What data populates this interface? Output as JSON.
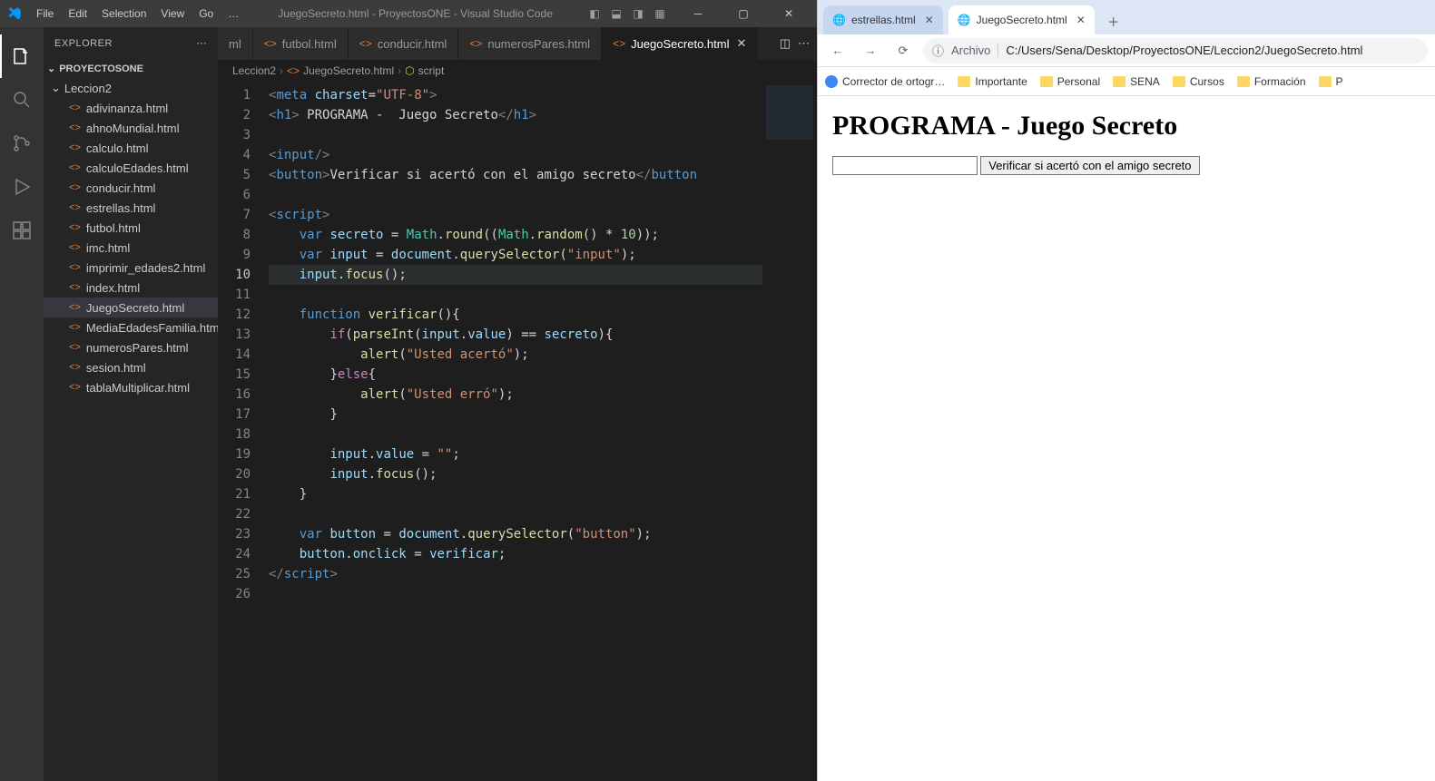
{
  "vscode": {
    "menus": [
      "File",
      "Edit",
      "Selection",
      "View",
      "Go",
      "…"
    ],
    "title": "JuegoSecreto.html - ProyectosONE - Visual Studio Code",
    "explorer": {
      "label": "EXPLORER",
      "project": "PROYECTOSONE",
      "folder": "Leccion2",
      "files": [
        "adivinanza.html",
        "ahnoMundial.html",
        "calculo.html",
        "calculoEdades.html",
        "conducir.html",
        "estrellas.html",
        "futbol.html",
        "imc.html",
        "imprimir_edades2.html",
        "index.html",
        "JuegoSecreto.html",
        "MediaEdadesFamilia.html",
        "numerosPares.html",
        "sesion.html",
        "tablaMultiplicar.html"
      ],
      "active": "JuegoSecreto.html"
    },
    "tabs": [
      {
        "label": "ml",
        "active": false,
        "partial": true
      },
      {
        "label": "futbol.html",
        "active": false
      },
      {
        "label": "conducir.html",
        "active": false
      },
      {
        "label": "numerosPares.html",
        "active": false
      },
      {
        "label": "JuegoSecreto.html",
        "active": true
      }
    ],
    "breadcrumbs": [
      "Leccion2",
      "JuegoSecreto.html",
      "script"
    ],
    "lineCount": 26,
    "activeLine": 10
  },
  "browser": {
    "tabs": [
      {
        "label": "estrellas.html",
        "active": false
      },
      {
        "label": "JuegoSecreto.html",
        "active": true
      }
    ],
    "addressLabel": "Archivo",
    "url": "C:/Users/Sena/Desktop/ProyectosONE/Leccion2/JuegoSecreto.html",
    "bookmarks": [
      "Corrector de ortogr…",
      "Importante",
      "Personal",
      "SENA",
      "Cursos",
      "Formación",
      "P"
    ],
    "pageTitle": "PROGRAMA - Juego Secreto",
    "buttonLabel": "Verificar si acertó con el amigo secreto"
  },
  "code": {
    "l1": {
      "charset": "charset",
      "utf": "\"UTF-8\""
    },
    "l2": {
      "text": " PROGRAMA -  Juego Secreto"
    },
    "l5": {
      "btn": "Verificar si acertó con el amigo secreto"
    },
    "l8": {
      "v": "secreto",
      "math": "Math",
      "round": "round",
      "random": "random",
      "ten": "10"
    },
    "l9": {
      "v": "input",
      "doc": "document",
      "qs": "querySelector",
      "sel": "\"input\""
    },
    "l10": {
      "inp": "input",
      "focus": "focus"
    },
    "l12": {
      "fn": "verificar"
    },
    "l13": {
      "pi": "parseInt",
      "inp": "input",
      "val": "value",
      "sec": "secreto"
    },
    "l14": {
      "alert": "alert",
      "msg": "\"Usted acertó\""
    },
    "l16": {
      "alert": "alert",
      "msg": "\"Usted erró\""
    },
    "l19": {
      "inp": "input",
      "val": "value",
      "empty": "\"\""
    },
    "l20": {
      "inp": "input",
      "focus": "focus"
    },
    "l23": {
      "v": "button",
      "doc": "document",
      "qs": "querySelector",
      "sel": "\"button\""
    },
    "l24": {
      "btn": "button",
      "oc": "onclick",
      "ver": "verificar"
    }
  }
}
